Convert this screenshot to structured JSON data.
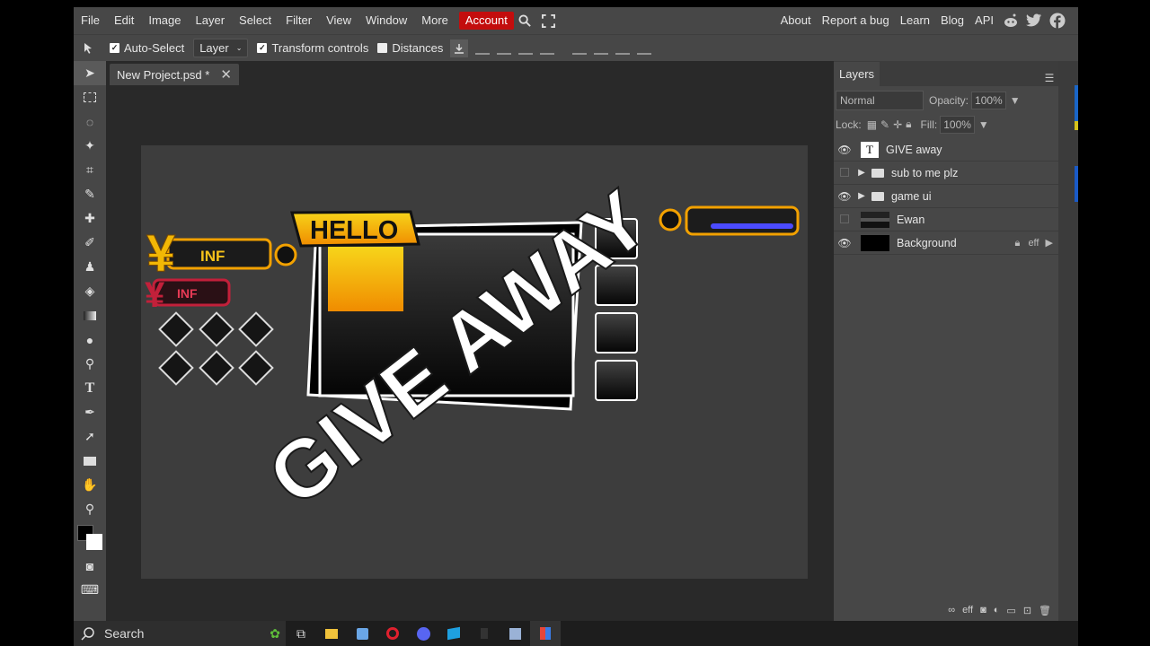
{
  "menu": {
    "items": [
      "File",
      "Edit",
      "Image",
      "Layer",
      "Select",
      "Filter",
      "View",
      "Window",
      "More"
    ],
    "account": "Account",
    "right_items": [
      "About",
      "Report a bug",
      "Learn",
      "Blog",
      "API"
    ]
  },
  "options": {
    "auto_select": "Auto-Select",
    "layer_select": "Layer",
    "transform_controls": "Transform controls",
    "distances": "Distances"
  },
  "document": {
    "tab_title": "New Project.psd *"
  },
  "canvas_art": {
    "hello": "HELLO",
    "inf_1": "INF",
    "inf_2": "INF",
    "yen": "¥",
    "give_away": "GIVE AWAY"
  },
  "layers_panel": {
    "title": "Layers",
    "blend_mode": "Normal",
    "opacity_label": "Opacity:",
    "opacity_value": "100%",
    "lock_label": "Lock:",
    "fill_label": "Fill:",
    "fill_value": "100%",
    "layers": [
      {
        "name": "GIVE away",
        "kind": "text",
        "visible": true
      },
      {
        "name": "sub to me plz",
        "kind": "folder",
        "visible": false
      },
      {
        "name": "game ui",
        "kind": "folder",
        "visible": true
      },
      {
        "name": "Ewan",
        "kind": "image",
        "visible": false
      },
      {
        "name": "Background",
        "kind": "background",
        "visible": true
      }
    ],
    "background_fx": "eff",
    "footer_fx": "eff"
  },
  "taskbar": {
    "search_placeholder": "Search"
  },
  "colors": {
    "accent": "#c30d0d",
    "ui_bg": "#474747",
    "canvas_bg": "#3d3d3d",
    "workspace_bg": "#292929"
  }
}
